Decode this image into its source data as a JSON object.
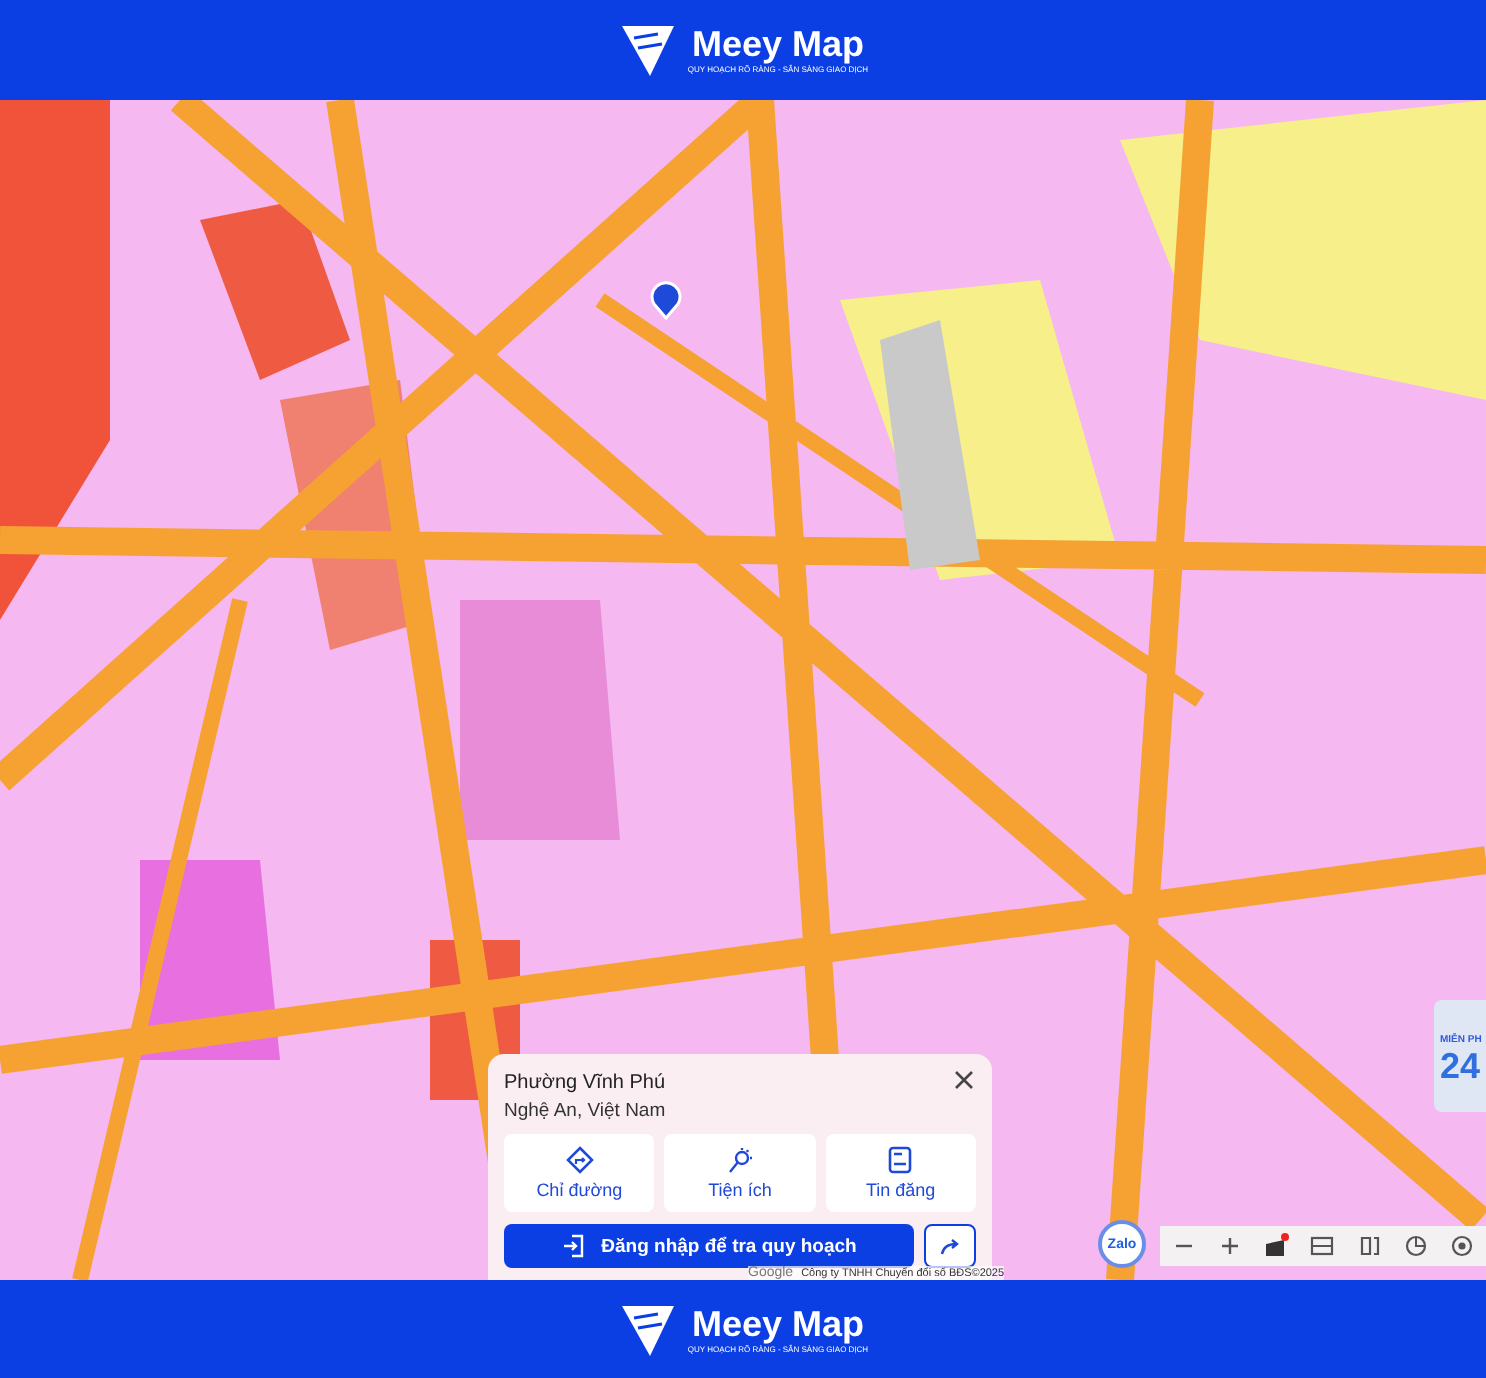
{
  "header": {
    "brand": "Meey Map",
    "tagline": "QUY HOẠCH RÕ RÀNG - SẴN SÀNG GIAO DỊCH"
  },
  "ad": {
    "headline": "MIỄN PH",
    "number": "24"
  },
  "place_card": {
    "title": "Phường Vĩnh Phú",
    "subtitle": "Nghệ An, Việt Nam",
    "actions": [
      {
        "kind": "directions",
        "label": "Chỉ đường"
      },
      {
        "kind": "amenities",
        "label": "Tiện ích"
      },
      {
        "kind": "listings",
        "label": "Tin đăng"
      }
    ],
    "login_button": "Đăng nhập để tra quy hoạch"
  },
  "attribution": {
    "provider": "Google",
    "text": "Công ty TNHH Chuyển đổi số BĐS©2025"
  },
  "zalo": "Zalo",
  "footer": {
    "brand": "Meey Map",
    "tagline": "QUY HOẠCH RÕ RÀNG - SẴN SÀNG GIAO DỊCH"
  }
}
